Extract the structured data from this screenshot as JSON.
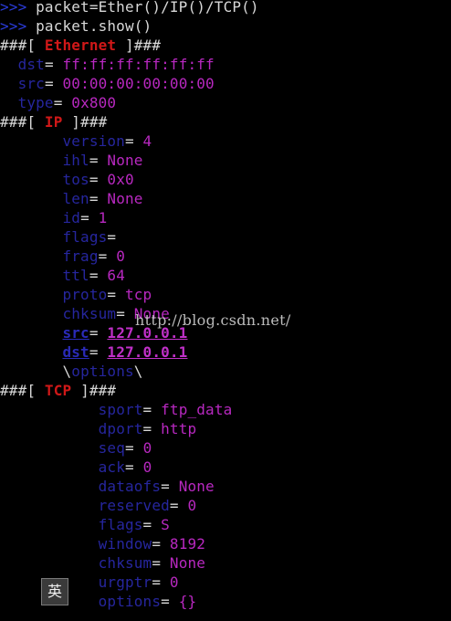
{
  "prompts": [
    {
      "prompt": ">>>",
      "command": " packet=Ether()/IP()/TCP()"
    },
    {
      "prompt": ">>>",
      "command": " packet.show()"
    }
  ],
  "layers": [
    {
      "name": "Ethernet",
      "indent": "  ",
      "fields": [
        {
          "name": "dst",
          "value": "ff:ff:ff:ff:ff:ff"
        },
        {
          "name": "src",
          "value": "00:00:00:00:00:00"
        },
        {
          "name": "type",
          "value": "0x800"
        }
      ]
    },
    {
      "name": "IP",
      "indent": "       ",
      "fields": [
        {
          "name": "version",
          "value": "4"
        },
        {
          "name": "ihl",
          "value": "None"
        },
        {
          "name": "tos",
          "value": "0x0"
        },
        {
          "name": "len",
          "value": "None"
        },
        {
          "name": "id",
          "value": "1"
        },
        {
          "name": "flags",
          "value": ""
        },
        {
          "name": "frag",
          "value": "0"
        },
        {
          "name": "ttl",
          "value": "64"
        },
        {
          "name": "proto",
          "value": "tcp"
        },
        {
          "name": "chksum",
          "value": "None"
        },
        {
          "name": "src",
          "value": "127.0.0.1",
          "bold": true
        },
        {
          "name": "dst",
          "value": "127.0.0.1",
          "bold": true
        }
      ],
      "options_label": "options"
    },
    {
      "name": "TCP",
      "indent": "           ",
      "fields": [
        {
          "name": "sport",
          "value": "ftp_data"
        },
        {
          "name": "dport",
          "value": "http"
        },
        {
          "name": "seq",
          "value": "0"
        },
        {
          "name": "ack",
          "value": "0"
        },
        {
          "name": "dataofs",
          "value": "None"
        },
        {
          "name": "reserved",
          "value": "0"
        },
        {
          "name": "flags",
          "value": "S"
        },
        {
          "name": "window",
          "value": "8192"
        },
        {
          "name": "chksum",
          "value": "None"
        },
        {
          "name": "urgptr",
          "value": "0"
        },
        {
          "name": "options",
          "value": "{}"
        }
      ]
    }
  ],
  "layer_prefix": "###[ ",
  "layer_suffix": " ]###",
  "equals": "= ",
  "watermark": "http://blog.csdn.net/",
  "ime_indicator": "英",
  "colors": {
    "background": "#000000",
    "prompt": "#2a3bd8",
    "layer_name": "#d01818",
    "field_name": "#26269e",
    "field_value": "#b828c0"
  }
}
